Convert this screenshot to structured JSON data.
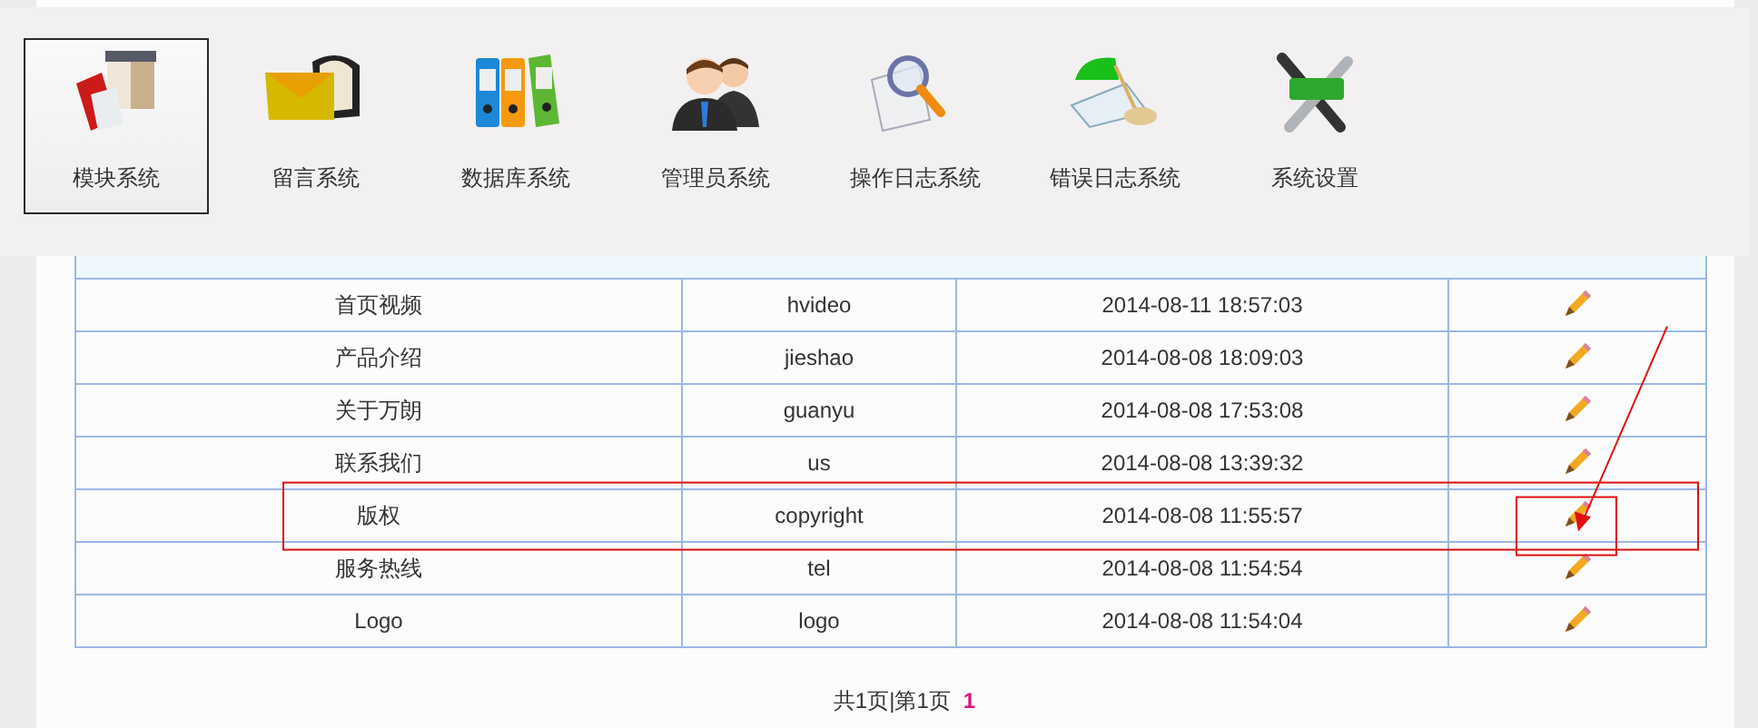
{
  "menu": [
    {
      "label": "模块系统",
      "kind": "box",
      "selected": true
    },
    {
      "label": "留言系统",
      "kind": "mail",
      "selected": false
    },
    {
      "label": "数据库系统",
      "kind": "binders",
      "selected": false
    },
    {
      "label": "管理员系统",
      "kind": "users",
      "selected": false
    },
    {
      "label": "操作日志系统",
      "kind": "magnifier",
      "selected": false
    },
    {
      "label": "错误日志系统",
      "kind": "lamp",
      "selected": false
    },
    {
      "label": "系统设置",
      "kind": "tools",
      "selected": false
    }
  ],
  "table": {
    "rows": [
      {
        "name": "首页视频",
        "key": "hvideo",
        "time": "2014-08-11 18:57:03",
        "annotated": false
      },
      {
        "name": "产品介绍",
        "key": "jieshao",
        "time": "2014-08-08 18:09:03",
        "annotated": false
      },
      {
        "name": "关于万朗",
        "key": "guanyu",
        "time": "2014-08-08 17:53:08",
        "annotated": false
      },
      {
        "name": "联系我们",
        "key": "us",
        "time": "2014-08-08 13:39:32",
        "annotated": false
      },
      {
        "name": "版权",
        "key": "copyright",
        "time": "2014-08-08 11:55:57",
        "annotated": true
      },
      {
        "name": "服务热线",
        "key": "tel",
        "time": "2014-08-08 11:54:54",
        "annotated": false
      },
      {
        "name": "Logo",
        "key": "logo",
        "time": "2014-08-08 11:54:04",
        "annotated": false
      }
    ]
  },
  "pager": {
    "summary": "共1页|第1页",
    "pages": [
      {
        "label": "1",
        "selected": true
      }
    ]
  }
}
